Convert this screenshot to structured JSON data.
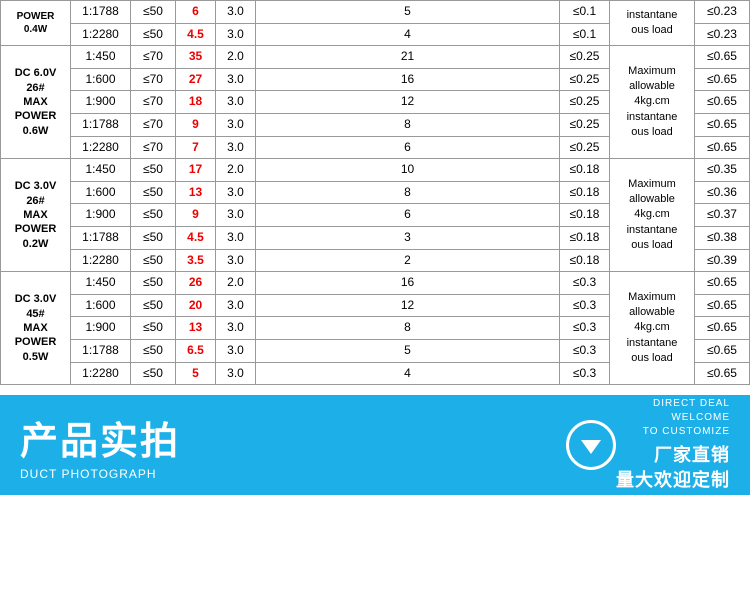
{
  "table": {
    "sections": [
      {
        "id": "dc6v_26_0.4w_continued",
        "rows": [
          {
            "ratio": "1:1788",
            "noload": "≤50",
            "stall": "6",
            "rated": "3.0",
            "current": "5",
            "noise": "≤0.1",
            "efficiency": "≤0.23"
          },
          {
            "ratio": "1:2280",
            "noload": "≤50",
            "stall": "4.5",
            "rated": "3.0",
            "current": "4",
            "noise": "≤0.1",
            "efficiency": "≤0.23"
          }
        ],
        "header": "",
        "maxload": "Instantaneous load"
      },
      {
        "id": "dc6v_26_0.6w",
        "header": "DC 6.0V\n26#\nMAX\nPOWER\n0.6W",
        "maxload": "Maximum allowable 4kg.cm instantaneous load",
        "rows": [
          {
            "ratio": "1:450",
            "noload": "≤70",
            "stall": "35",
            "rated": "2.0",
            "current": "21",
            "noise": "≤0.25",
            "efficiency": "≤0.65"
          },
          {
            "ratio": "1:600",
            "noload": "≤70",
            "stall": "27",
            "rated": "3.0",
            "current": "16",
            "noise": "≤0.25",
            "efficiency": "≤0.65"
          },
          {
            "ratio": "1:900",
            "noload": "≤70",
            "stall": "18",
            "rated": "3.0",
            "current": "12",
            "noise": "≤0.25",
            "efficiency": "≤0.65"
          },
          {
            "ratio": "1:1788",
            "noload": "≤70",
            "stall": "9",
            "rated": "3.0",
            "current": "8",
            "noise": "≤0.25",
            "efficiency": "≤0.65"
          },
          {
            "ratio": "1:2280",
            "noload": "≤70",
            "stall": "7",
            "rated": "3.0",
            "current": "6",
            "noise": "≤0.25",
            "efficiency": "≤0.65"
          }
        ]
      },
      {
        "id": "dc3v_26_0.2w",
        "header": "DC 3.0V\n26#\nMAX\nPOWER\n0.2W",
        "maxload": "Maximum allowable 4kg.cm instantaneous load",
        "rows": [
          {
            "ratio": "1:450",
            "noload": "≤50",
            "stall": "17",
            "rated": "2.0",
            "current": "10",
            "noise": "≤0.18",
            "efficiency": "≤0.35"
          },
          {
            "ratio": "1:600",
            "noload": "≤50",
            "stall": "13",
            "rated": "3.0",
            "current": "8",
            "noise": "≤0.18",
            "efficiency": "≤0.36"
          },
          {
            "ratio": "1:900",
            "noload": "≤50",
            "stall": "9",
            "rated": "3.0",
            "current": "6",
            "noise": "≤0.18",
            "efficiency": "≤0.37"
          },
          {
            "ratio": "1:1788",
            "noload": "≤50",
            "stall": "4.5",
            "rated": "3.0",
            "current": "3",
            "noise": "≤0.18",
            "efficiency": "≤0.38"
          },
          {
            "ratio": "1:2280",
            "noload": "≤50",
            "stall": "3.5",
            "rated": "3.0",
            "current": "2",
            "noise": "≤0.18",
            "efficiency": "≤0.39"
          }
        ]
      },
      {
        "id": "dc3v_45_0.5w",
        "header": "DC 3.0V\n45#\nMAX\nPOWER\n0.5W",
        "maxload": "Maximum allowable 4kg.cm instantaneous load",
        "rows": [
          {
            "ratio": "1:450",
            "noload": "≤50",
            "stall": "26",
            "rated": "2.0",
            "current": "16",
            "noise": "≤0.3",
            "efficiency": "≤0.65"
          },
          {
            "ratio": "1:600",
            "noload": "≤50",
            "stall": "20",
            "rated": "3.0",
            "current": "12",
            "noise": "≤0.3",
            "efficiency": "≤0.65"
          },
          {
            "ratio": "1:900",
            "noload": "≤50",
            "stall": "13",
            "rated": "3.0",
            "current": "8",
            "noise": "≤0.3",
            "efficiency": "≤0.65"
          },
          {
            "ratio": "1:1788",
            "noload": "≤50",
            "stall": "6.5",
            "rated": "3.0",
            "current": "5",
            "noise": "≤0.3",
            "efficiency": "≤0.65"
          },
          {
            "ratio": "1:2280",
            "noload": "≤50",
            "stall": "5",
            "rated": "3.0",
            "current": "4",
            "noise": "≤0.3",
            "efficiency": "≤0.65"
          }
        ]
      }
    ]
  },
  "banner": {
    "title": "产品实拍",
    "subtitle": "DUCT PHOTOGRAPH",
    "right_top_line1": "DIRECT DEAL",
    "right_top_line2": "WELCOME",
    "right_top_line3": "TO CUSTOMIZE",
    "right_bottom": "厂家直销\n量大欢迎定制"
  }
}
